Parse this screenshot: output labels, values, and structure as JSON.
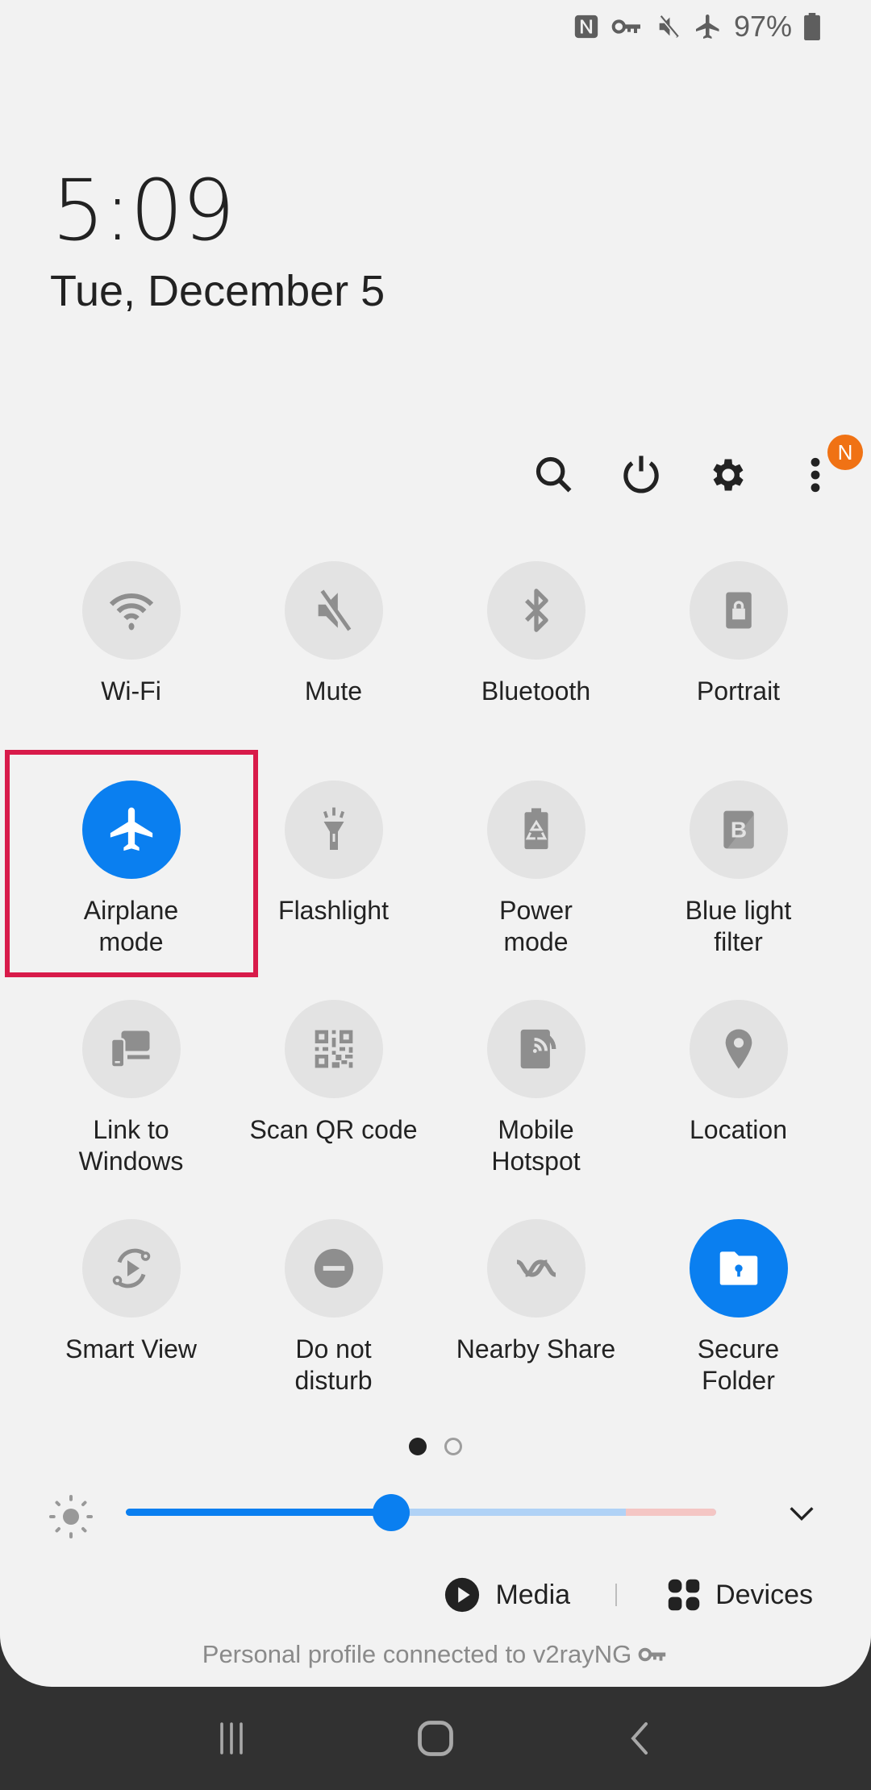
{
  "status_bar": {
    "icons": [
      "nfc-icon",
      "vpn-key-icon",
      "mute-icon",
      "airplane-icon",
      "battery-icon"
    ],
    "battery_percent": "97%"
  },
  "clock": {
    "time": "5:09",
    "date": "Tue, December 5"
  },
  "actions": {
    "icons": [
      "search-icon",
      "power-icon",
      "settings-icon",
      "more-options-icon"
    ],
    "notification_badge": "N"
  },
  "tiles": [
    {
      "label": "Wi-Fi",
      "icon": "wifi-icon",
      "on": false
    },
    {
      "label": "Mute",
      "icon": "mute-icon",
      "on": false
    },
    {
      "label": "Bluetooth",
      "icon": "bluetooth-icon",
      "on": false
    },
    {
      "label": "Portrait",
      "icon": "portrait-lock-icon",
      "on": false
    },
    {
      "label": "Airplane\nmode",
      "icon": "airplane-icon",
      "on": true
    },
    {
      "label": "Flashlight",
      "icon": "flashlight-icon",
      "on": false
    },
    {
      "label": "Power\nmode",
      "icon": "power-mode-icon",
      "on": false
    },
    {
      "label": "Blue light\nfilter",
      "icon": "blue-light-icon",
      "on": false
    },
    {
      "label": "Link to\nWindows",
      "icon": "link-windows-icon",
      "on": false
    },
    {
      "label": "Scan QR code",
      "icon": "qr-code-icon",
      "on": false
    },
    {
      "label": "Mobile\nHotspot",
      "icon": "hotspot-icon",
      "on": false
    },
    {
      "label": "Location",
      "icon": "location-icon",
      "on": false
    },
    {
      "label": "Smart View",
      "icon": "smart-view-icon",
      "on": false
    },
    {
      "label": "Do not\ndisturb",
      "icon": "do-not-disturb-icon",
      "on": false
    },
    {
      "label": "Nearby Share",
      "icon": "nearby-share-icon",
      "on": false
    },
    {
      "label": "Secure\nFolder",
      "icon": "secure-folder-icon",
      "on": true
    }
  ],
  "pager": {
    "pages": 2,
    "current": 1
  },
  "brightness": {
    "level": 0.45
  },
  "bottom": {
    "media_label": "Media",
    "devices_label": "Devices"
  },
  "profile_text": "Personal profile connected to v2rayNG",
  "colors": {
    "accent": "#0a7ff0",
    "badge": "#f07214",
    "highlight": "#d81b4a",
    "tile_off": "#e3e3e3",
    "icon_off": "#8e8e8e"
  }
}
